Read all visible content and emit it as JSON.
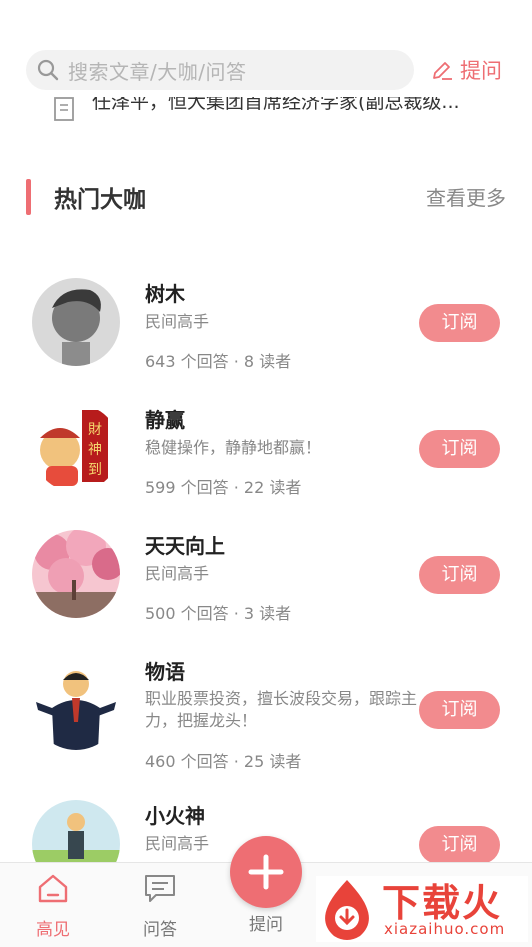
{
  "search": {
    "placeholder": "搜索文章/大咖/问答",
    "ask_label": "提问"
  },
  "ticker": {
    "text": "任泽平，恒大集团首席经济学家(副总裁级..."
  },
  "section": {
    "title": "热门大咖",
    "more": "查看更多"
  },
  "subscribe_label": "订阅",
  "experts": [
    {
      "name": "树木",
      "desc": "民间高手",
      "stats": "643 个回答 · 8 读者"
    },
    {
      "name": "静赢",
      "desc": "稳健操作，静静地都赢！",
      "stats": "599 个回答 · 22 读者"
    },
    {
      "name": "天天向上",
      "desc": "民间高手",
      "stats": "500 个回答 · 3 读者"
    },
    {
      "name": "物语",
      "desc": "职业股票投资，擅长波段交易，跟踪主力，把握龙头！",
      "stats": "460 个回答 · 25 读者"
    },
    {
      "name": "小火神",
      "desc": "民间高手",
      "stats": ""
    }
  ],
  "avatar_text": {
    "fortune_sign": "財神到"
  },
  "tabs": [
    {
      "label": "高见",
      "icon": "home-icon",
      "active": true
    },
    {
      "label": "问答",
      "icon": "chat-icon",
      "active": false
    },
    {
      "label": "提问",
      "icon": "plus-icon",
      "active": false
    }
  ],
  "watermark": {
    "title": "下载火",
    "domain": "xiazaihuo.com"
  },
  "colors": {
    "accent": "#ee6e73",
    "button": "#f28b8e",
    "watermark": "#e8433a"
  }
}
